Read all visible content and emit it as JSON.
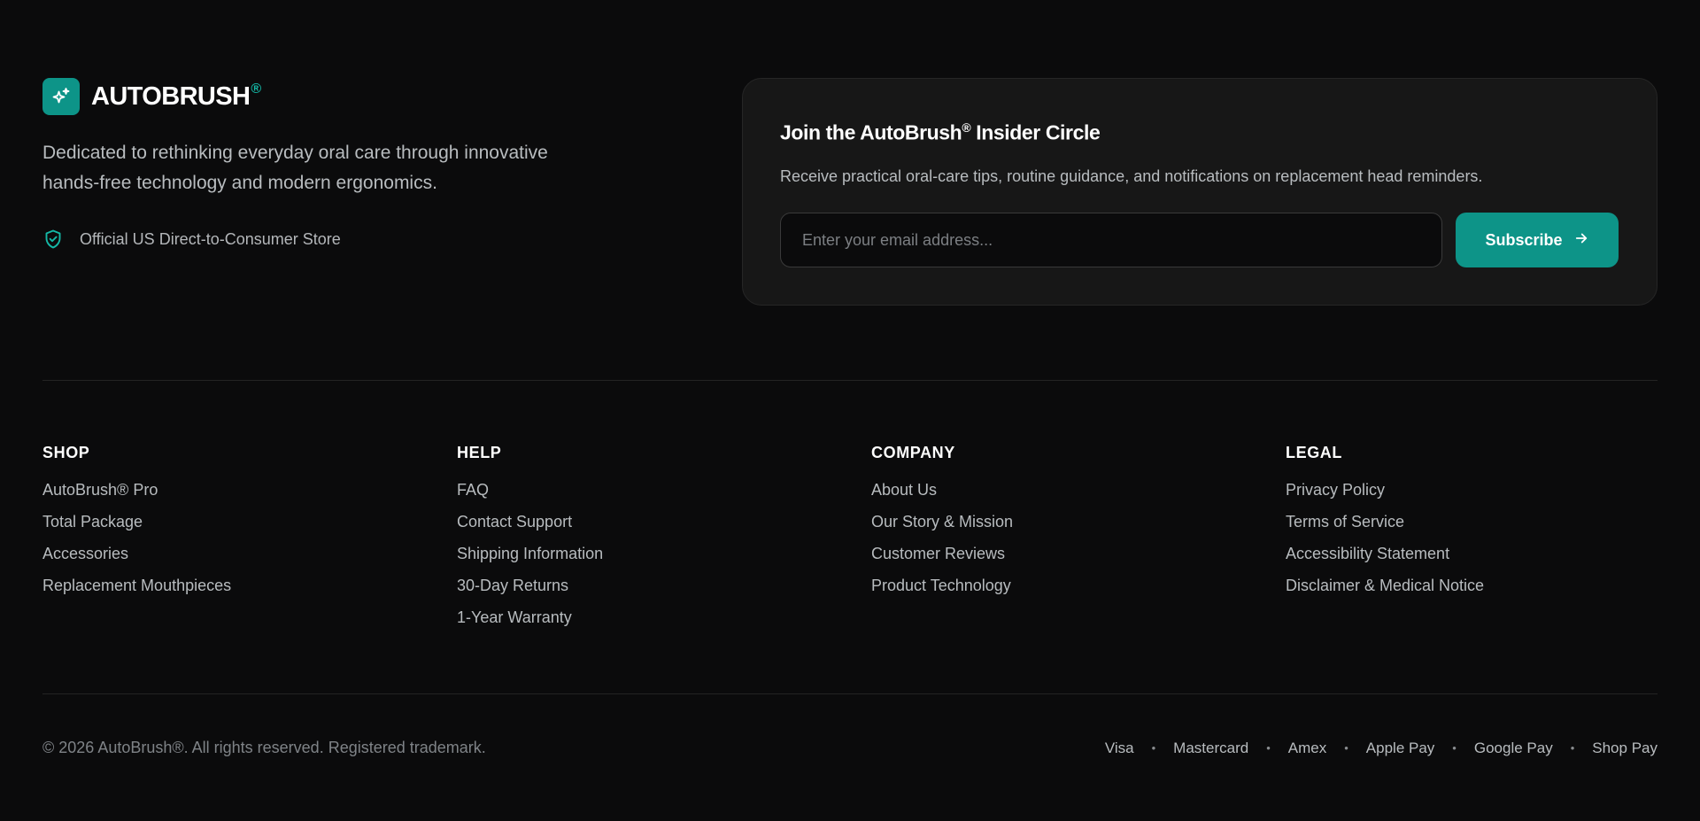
{
  "brand": {
    "name": "AUTOBRUSH",
    "reg": "®",
    "description": "Dedicated to rethinking everyday oral care through innovative hands-free technology and modern ergonomics.",
    "official_store": "Official US Direct-to-Consumer Store",
    "icons": {
      "logo": "sparkles-icon",
      "official": "shield-check-icon"
    },
    "accent_color": "#0d9488"
  },
  "newsletter": {
    "title": "Join the AutoBrush",
    "title_reg": "®",
    "title_suffix": " Insider Circle",
    "description": "Receive practical oral-care tips, routine guidance, and notifications on replacement head reminders.",
    "email_placeholder": "Enter your email address...",
    "email_value": "",
    "subscribe_label": "Subscribe",
    "subscribe_icon": "arrow-right-icon"
  },
  "columns": [
    {
      "title": "SHOP",
      "links": [
        "AutoBrush® Pro",
        "Total Package",
        "Accessories",
        "Replacement Mouthpieces"
      ]
    },
    {
      "title": "HELP",
      "links": [
        "FAQ",
        "Contact Support",
        "Shipping Information",
        "30-Day Returns",
        "1-Year Warranty"
      ]
    },
    {
      "title": "COMPANY",
      "links": [
        "About Us",
        "Our Story & Mission",
        "Customer Reviews",
        "Product Technology"
      ]
    },
    {
      "title": "LEGAL",
      "links": [
        "Privacy Policy",
        "Terms of Service",
        "Accessibility Statement",
        "Disclaimer & Medical Notice"
      ]
    }
  ],
  "bottom": {
    "copyright": "© 2026 AutoBrush®. All rights reserved. Registered trademark.",
    "payments": [
      "Visa",
      "Mastercard",
      "Amex",
      "Apple Pay",
      "Google Pay",
      "Shop Pay"
    ],
    "separator": "•"
  }
}
